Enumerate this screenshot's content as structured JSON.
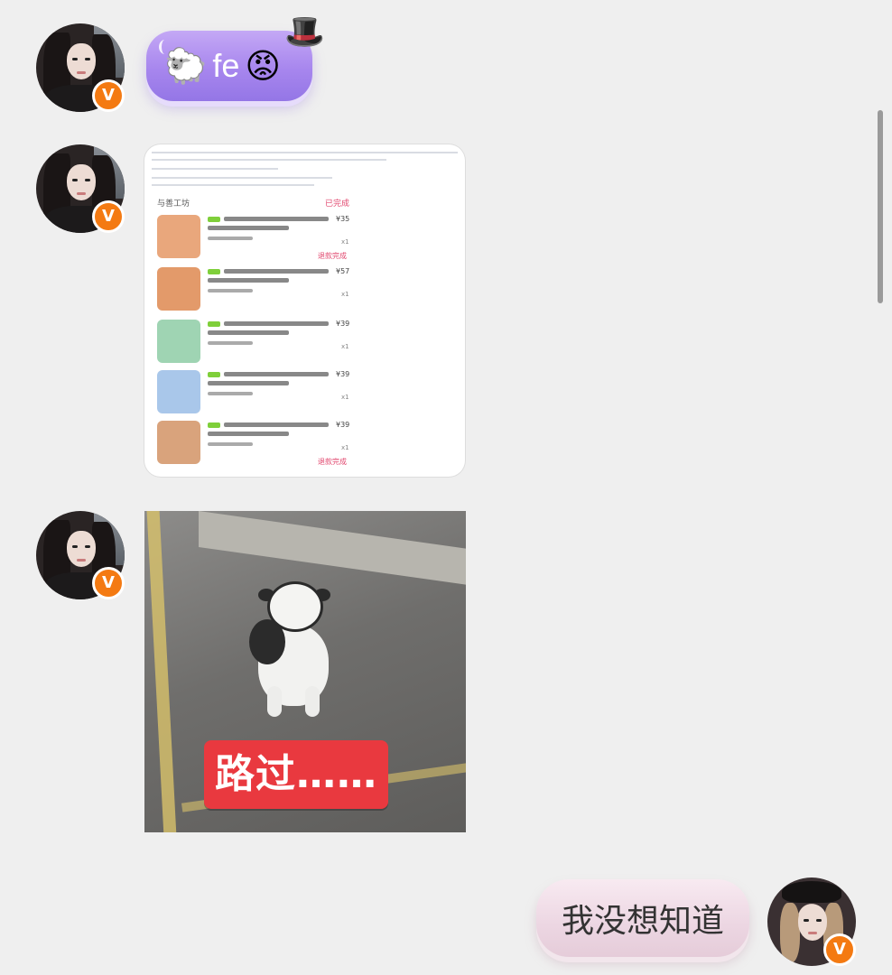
{
  "messages": [
    {
      "sender": "other",
      "type": "sticker",
      "emoji": "🐑",
      "text": "fe",
      "emoji2": "😡",
      "hat": "🎩"
    },
    {
      "sender": "other",
      "type": "image",
      "content": "order screenshot"
    },
    {
      "sender": "other",
      "type": "image",
      "content": "meme",
      "caption": "路过……"
    },
    {
      "sender": "self",
      "type": "text",
      "text": "我没想知道"
    }
  ],
  "shot": {
    "header": "与善工坊",
    "status": "已完成",
    "orders": [
      {
        "price": "¥35",
        "qty": "x1",
        "action": "退款完成",
        "thumb_color": "#e9a77c"
      },
      {
        "price": "¥57",
        "qty": "x1",
        "action": "",
        "thumb_color": "#e39a6a"
      },
      {
        "price": "¥39",
        "qty": "x1",
        "action": "",
        "thumb_color": "#9fd4b3"
      },
      {
        "price": "¥39",
        "qty": "x1",
        "action": "",
        "thumb_color": "#a9c7ea"
      },
      {
        "price": "¥39",
        "qty": "x1",
        "action": "退款完成",
        "thumb_color": "#d9a37c"
      }
    ]
  },
  "badge": "V",
  "colors": {
    "background": "#efefef",
    "sticker_bubble": "#a786ee",
    "self_bubble": "#ecd6e2",
    "verified_badge": "#f47a12",
    "meme_caption": "#e9393f"
  }
}
